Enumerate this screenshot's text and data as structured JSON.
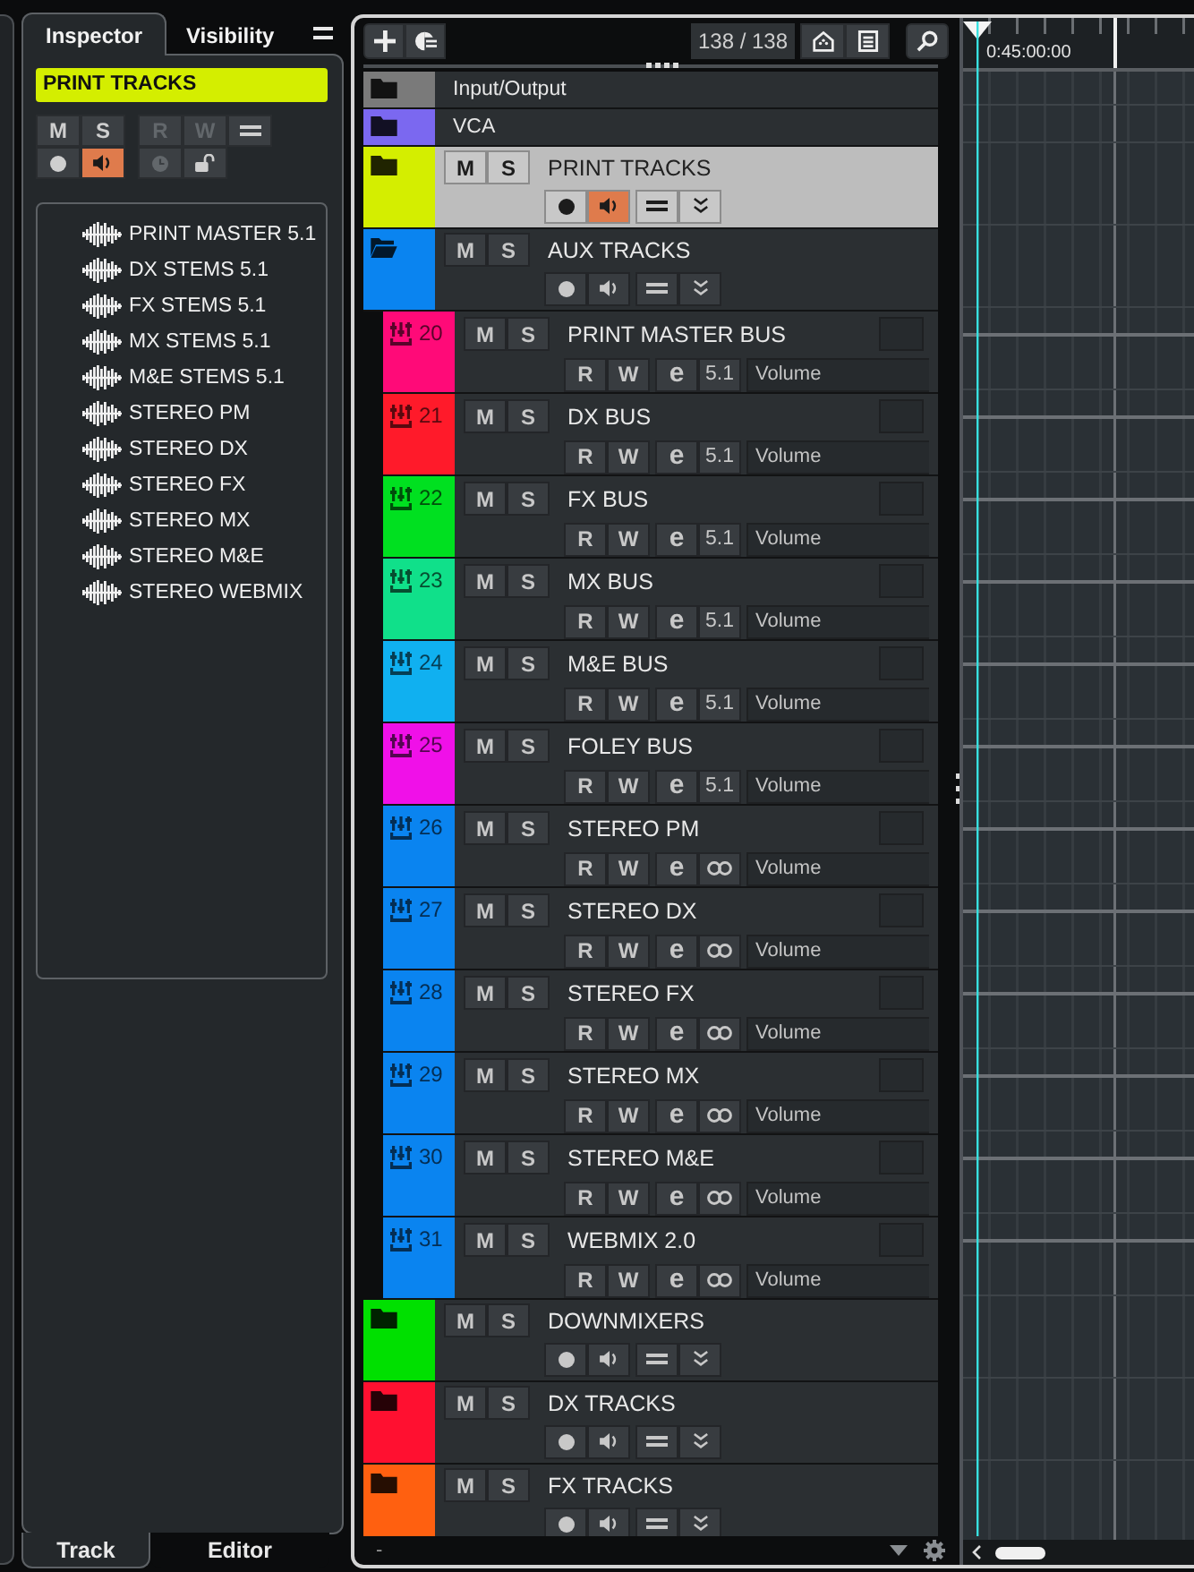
{
  "inspector": {
    "tabs": [
      {
        "label": "Inspector",
        "selected": true
      },
      {
        "label": "Visibility",
        "selected": false
      }
    ],
    "track_name": "PRINT TRACKS",
    "button_rows": [
      [
        {
          "kind": "mute",
          "label": "M",
          "on": false,
          "disabled": false
        },
        {
          "kind": "solo",
          "label": "S",
          "on": false,
          "disabled": false
        },
        {
          "kind": "read",
          "label": "R",
          "on": false,
          "disabled": true
        },
        {
          "kind": "write",
          "label": "W",
          "on": false,
          "disabled": true
        },
        {
          "kind": "lanes",
          "on": false,
          "disabled": false
        }
      ],
      [
        {
          "kind": "record",
          "on": false,
          "disabled": false
        },
        {
          "kind": "monitor",
          "on": true,
          "disabled": false
        },
        {
          "kind": "timer",
          "on": false,
          "disabled": true
        },
        {
          "kind": "lock",
          "on": false,
          "disabled": false
        }
      ]
    ],
    "tracks": [
      {
        "name": "PRINT MASTER 5.1"
      },
      {
        "name": "DX STEMS 5.1"
      },
      {
        "name": "FX STEMS 5.1"
      },
      {
        "name": "MX STEMS 5.1"
      },
      {
        "name": "M&E STEMS 5.1"
      },
      {
        "name": "STEREO PM"
      },
      {
        "name": "STEREO DX"
      },
      {
        "name": "STEREO FX"
      },
      {
        "name": "STEREO MX"
      },
      {
        "name": "STEREO M&E"
      },
      {
        "name": "STEREO WEBMIX"
      }
    ],
    "bottom_tabs": [
      {
        "label": "Track",
        "selected": true
      },
      {
        "label": "Editor",
        "selected": false
      }
    ]
  },
  "track_list": {
    "counter": "138 / 138",
    "tracks": [
      {
        "kind": "compact",
        "name": "Input/Output",
        "color": "#7a7a7a",
        "selected": false,
        "expanded": false
      },
      {
        "kind": "compact",
        "name": "VCA",
        "color": "#7b68f0",
        "selected": false,
        "expanded": false
      },
      {
        "kind": "folder",
        "name": "PRINT TRACKS",
        "color": "#d4ee00",
        "selected": true,
        "expanded": false,
        "mute": "M",
        "solo": "S",
        "monitor": true
      },
      {
        "kind": "folder",
        "name": "AUX TRACKS",
        "color": "#0a84f0",
        "selected": false,
        "expanded": true,
        "mute": "M",
        "solo": "S",
        "monitor": false
      },
      {
        "kind": "group",
        "number": "20",
        "name": "PRINT MASTER BUS",
        "color": "#ff0a78",
        "selected": false,
        "mute": "M",
        "solo": "S",
        "read": "R",
        "write": "W",
        "edit": "e",
        "format": "5.1",
        "parameter": "Volume"
      },
      {
        "kind": "group",
        "number": "21",
        "name": "DX BUS",
        "color": "#ff1a2a",
        "selected": false,
        "mute": "M",
        "solo": "S",
        "read": "R",
        "write": "W",
        "edit": "e",
        "format": "5.1",
        "parameter": "Volume"
      },
      {
        "kind": "group",
        "number": "22",
        "name": "FX BUS",
        "color": "#00e020",
        "selected": false,
        "mute": "M",
        "solo": "S",
        "read": "R",
        "write": "W",
        "edit": "e",
        "format": "5.1",
        "parameter": "Volume"
      },
      {
        "kind": "group",
        "number": "23",
        "name": "MX BUS",
        "color": "#10e08a",
        "selected": false,
        "mute": "M",
        "solo": "S",
        "read": "R",
        "write": "W",
        "edit": "e",
        "format": "5.1",
        "parameter": "Volume"
      },
      {
        "kind": "group",
        "number": "24",
        "name": "M&E BUS",
        "color": "#10b0f0",
        "selected": false,
        "mute": "M",
        "solo": "S",
        "read": "R",
        "write": "W",
        "edit": "e",
        "format": "5.1",
        "parameter": "Volume"
      },
      {
        "kind": "group",
        "number": "25",
        "name": "FOLEY BUS",
        "color": "#f010e8",
        "selected": false,
        "mute": "M",
        "solo": "S",
        "read": "R",
        "write": "W",
        "edit": "e",
        "format": "5.1",
        "parameter": "Volume"
      },
      {
        "kind": "group",
        "number": "26",
        "name": "STEREO PM",
        "color": "#0a84f0",
        "selected": false,
        "mute": "M",
        "solo": "S",
        "read": "R",
        "write": "W",
        "edit": "e",
        "parameter": "Volume"
      },
      {
        "kind": "group",
        "number": "27",
        "name": "STEREO DX",
        "color": "#0a84f0",
        "selected": false,
        "mute": "M",
        "solo": "S",
        "read": "R",
        "write": "W",
        "edit": "e",
        "parameter": "Volume"
      },
      {
        "kind": "group",
        "number": "28",
        "name": "STEREO FX",
        "color": "#0a84f0",
        "selected": false,
        "mute": "M",
        "solo": "S",
        "read": "R",
        "write": "W",
        "edit": "e",
        "parameter": "Volume"
      },
      {
        "kind": "group",
        "number": "29",
        "name": "STEREO MX",
        "color": "#0a84f0",
        "selected": false,
        "mute": "M",
        "solo": "S",
        "read": "R",
        "write": "W",
        "edit": "e",
        "parameter": "Volume"
      },
      {
        "kind": "group",
        "number": "30",
        "name": "STEREO M&E",
        "color": "#0a84f0",
        "selected": false,
        "mute": "M",
        "solo": "S",
        "read": "R",
        "write": "W",
        "edit": "e",
        "parameter": "Volume"
      },
      {
        "kind": "group",
        "number": "31",
        "name": "WEBMIX 2.0",
        "color": "#0a84f0",
        "selected": false,
        "mute": "M",
        "solo": "S",
        "read": "R",
        "write": "W",
        "edit": "e",
        "parameter": "Volume"
      },
      {
        "kind": "folder",
        "name": "DOWNMIXERS",
        "color": "#00e000",
        "selected": false,
        "expanded": false,
        "mute": "M",
        "solo": "S",
        "monitor": false
      },
      {
        "kind": "folder",
        "name": "DX TRACKS",
        "color": "#ff1030",
        "selected": false,
        "expanded": false,
        "mute": "M",
        "solo": "S",
        "monitor": false
      },
      {
        "kind": "folder",
        "name": "FX TRACKS",
        "color": "#ff6010",
        "selected": false,
        "expanded": false,
        "mute": "M",
        "solo": "S",
        "monitor": false
      }
    ],
    "footer_label": "-"
  },
  "timeline": {
    "timecode": "0:45:00:00"
  }
}
